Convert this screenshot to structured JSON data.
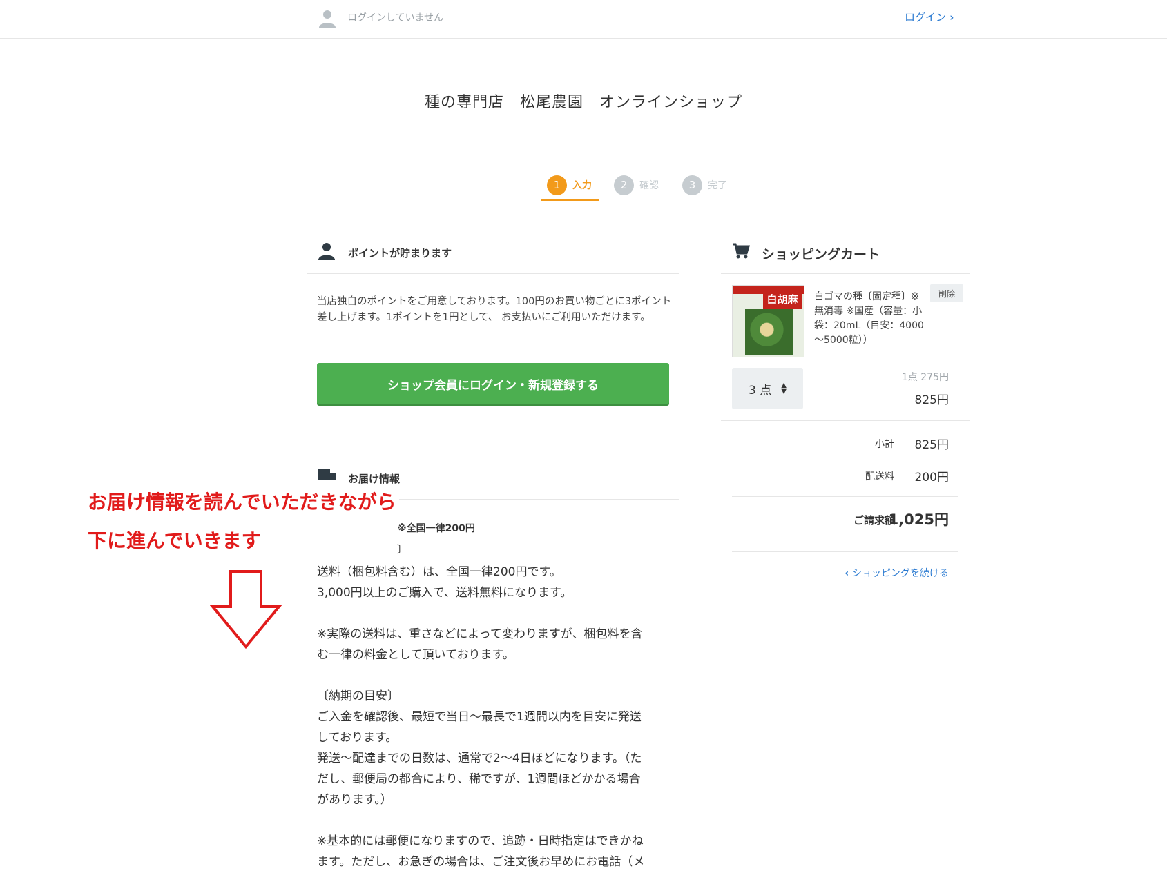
{
  "header": {
    "login_status": "ログインしていません",
    "login_link": "ログイン"
  },
  "shop_title": "種の専門店　松尾農園　オンラインショップ",
  "steps": [
    {
      "num": "1",
      "label": "入力"
    },
    {
      "num": "2",
      "label": "確認"
    },
    {
      "num": "3",
      "label": "完了"
    }
  ],
  "points": {
    "heading": "ポイントが貯まります",
    "text": "当店独自のポイントをご用意しております。100円のお買い物ごとに3ポイント差し上げます。1ポイントを1円として、 お支払いにご利用いただけます。",
    "login_button": "ショップ会員にログイン・新規登録する"
  },
  "delivery": {
    "heading": "お届け情報",
    "partial_line1": "※全国一律200円",
    "partial_line2": "〕",
    "lines": [
      "送料（梱包料含む）は、全国一律200円です。",
      "3,000円以上のご購入で、送料無料になります。",
      "",
      "※実際の送料は、重さなどによって変わりますが、梱包料を含",
      "む一律の料金として頂いております。",
      "",
      "〔納期の目安〕",
      "ご入金を確認後、最短で当日～最長で1週間以内を目安に発送",
      "しております。",
      "発送～配達までの日数は、通常で2～4日ほどになります。（た",
      "だし、郵便局の都合により、稀ですが、1週間ほどかかる場合",
      "があります。）",
      "",
      "※基本的には郵便になりますので、追跡・日時指定はできかね",
      "ます。ただし、お急ぎの場合は、ご注文後お早めにお電話（メ"
    ]
  },
  "cart": {
    "heading": "ショッピングカート",
    "item": {
      "name": "白ゴマの種〔固定種〕※無消毒 ※国産（容量：小袋：20mL（目安：4000～5000粒））",
      "image_text": "白胡麻",
      "delete_label": "削除",
      "qty": "3 点",
      "unit_price": "1点 275円",
      "line_total": "825円"
    },
    "subtotal_label": "小計",
    "subtotal": "825円",
    "shipping_label": "配送料",
    "shipping": "200円",
    "total_label": "ご請求額",
    "total": "1,025円",
    "continue_link": "ショッピングを続ける"
  },
  "annotation": {
    "line1": "お届け情報を読んでいただきながら",
    "line2": "下に進んでいきます",
    "color": "#e11b1b"
  },
  "colors": {
    "accent_orange": "#f29a1a",
    "button_green": "#4caf50",
    "link_blue": "#2a7ad1"
  }
}
